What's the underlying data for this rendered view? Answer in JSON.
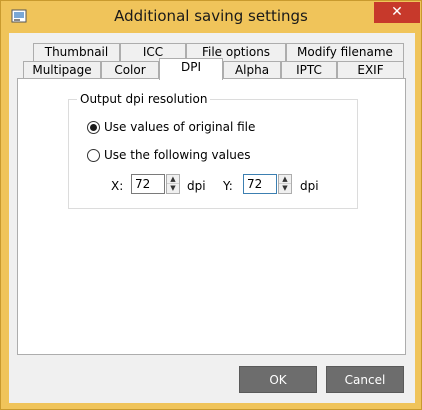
{
  "window": {
    "title": "Additional saving settings",
    "close_glyph": "✕"
  },
  "tabs_row1": [
    {
      "label": "Thumbnail"
    },
    {
      "label": "ICC"
    },
    {
      "label": "File options"
    },
    {
      "label": "Modify filename"
    }
  ],
  "tabs_row2": [
    {
      "label": "Multipage"
    },
    {
      "label": "Color"
    },
    {
      "label": "DPI",
      "active": true
    },
    {
      "label": "Alpha"
    },
    {
      "label": "IPTC"
    },
    {
      "label": "EXIF"
    }
  ],
  "dpi": {
    "group_title": "Output dpi resolution",
    "option_original": "Use values of original file",
    "option_following": "Use the following values",
    "selected": "option_original",
    "x_label": "X:",
    "x_value": "72",
    "x_unit": "dpi",
    "y_label": "Y:",
    "y_value": "72",
    "y_unit": "dpi"
  },
  "buttons": {
    "ok": "OK",
    "cancel": "Cancel"
  },
  "colors": {
    "titlebar": "#f0c45a",
    "close": "#c7392b",
    "button": "#6d6d6d"
  }
}
